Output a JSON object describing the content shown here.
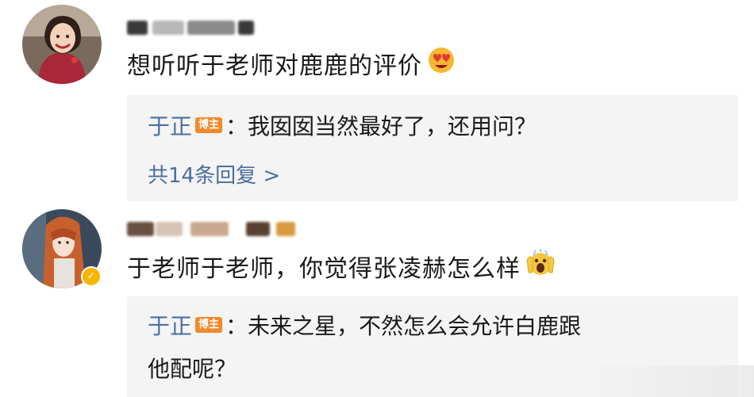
{
  "comments": [
    {
      "username": "",
      "text": "想听听于老师对鹿鹿的评价",
      "emoji": "heart-eyes-emoji",
      "reply": {
        "author": "于正",
        "badge": "博主",
        "separator": "：",
        "text": "我囡囡当然最好了，还用问？",
        "more": "共14条回复 >"
      }
    },
    {
      "username": "",
      "text": "于老师于老师，你觉得张凌赫怎么样",
      "emoji": "screaming-emoji",
      "reply": {
        "author": "于正",
        "badge": "博主",
        "separator": "：",
        "text_line1": "未来之星，不然怎么会允许白鹿跟",
        "text_line2": "他配呢？"
      }
    }
  ],
  "colors": {
    "link": "#4a6fa0",
    "badge": "#f08a2c",
    "reply_bg": "#f4f4f4",
    "verified": "#f7b500"
  }
}
